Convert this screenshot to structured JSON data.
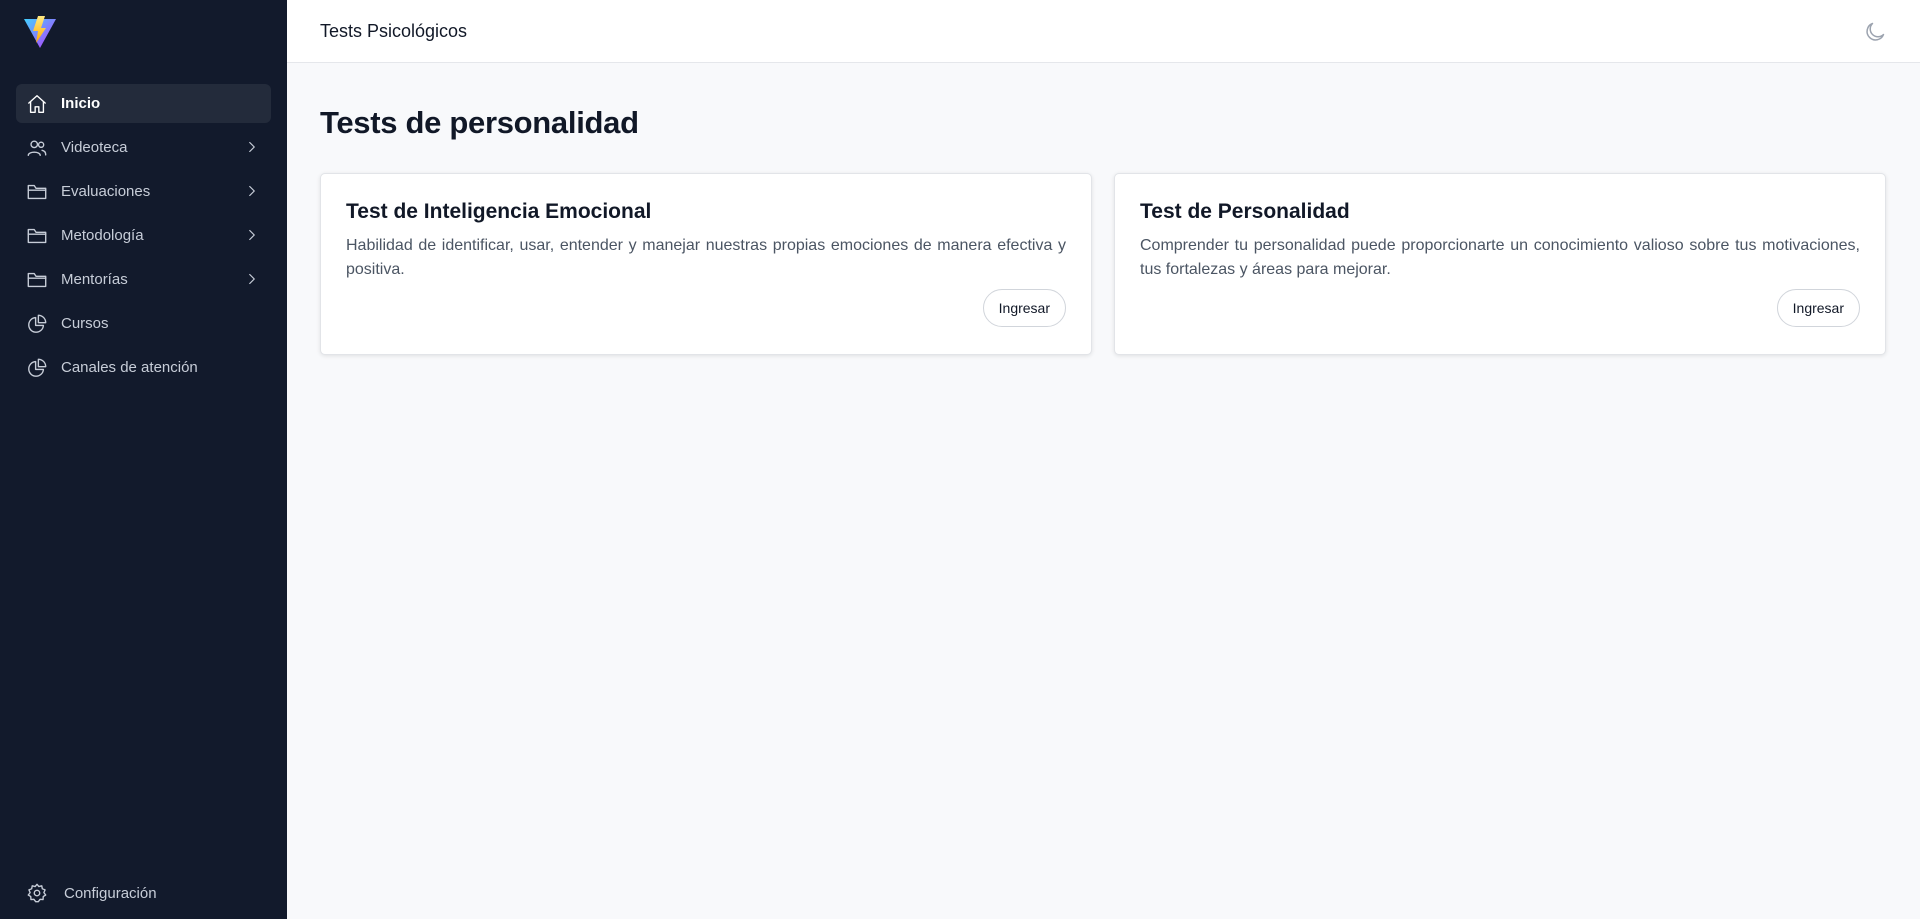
{
  "header": {
    "title": "Tests Psicológicos",
    "theme_icon": "moon-icon"
  },
  "sidebar": {
    "logo": "vite-logo",
    "items": [
      {
        "label": "Inicio",
        "icon": "home-icon",
        "active": true,
        "has_submenu": false
      },
      {
        "label": "Videoteca",
        "icon": "users-icon",
        "active": false,
        "has_submenu": true
      },
      {
        "label": "Evaluaciones",
        "icon": "folder-icon",
        "active": false,
        "has_submenu": true
      },
      {
        "label": "Metodología",
        "icon": "folder-icon",
        "active": false,
        "has_submenu": true
      },
      {
        "label": "Mentorías",
        "icon": "folder-icon",
        "active": false,
        "has_submenu": true
      },
      {
        "label": "Cursos",
        "icon": "pie-chart-icon",
        "active": false,
        "has_submenu": false
      },
      {
        "label": "Canales de atención",
        "icon": "pie-chart-icon",
        "active": false,
        "has_submenu": false
      }
    ],
    "settings": {
      "label": "Configuración",
      "icon": "gear-icon"
    }
  },
  "main": {
    "title": "Tests de personalidad",
    "cards": [
      {
        "title": "Test de Inteligencia Emocional",
        "description": "Habilidad de identificar, usar, entender y manejar nuestras propias emociones de manera efectiva y positiva.",
        "button": "Ingresar"
      },
      {
        "title": "Test de Personalidad",
        "description": "Comprender tu personalidad puede proporcionarte un conocimiento valioso sobre tus motivaciones, tus fortalezas y áreas para mejorar.",
        "button": "Ingresar"
      }
    ]
  },
  "colors": {
    "sidebar_bg": "#121a2c",
    "sidebar_active": "#232b3b",
    "page_bg": "#f8f9fb",
    "text_primary": "#111827"
  }
}
